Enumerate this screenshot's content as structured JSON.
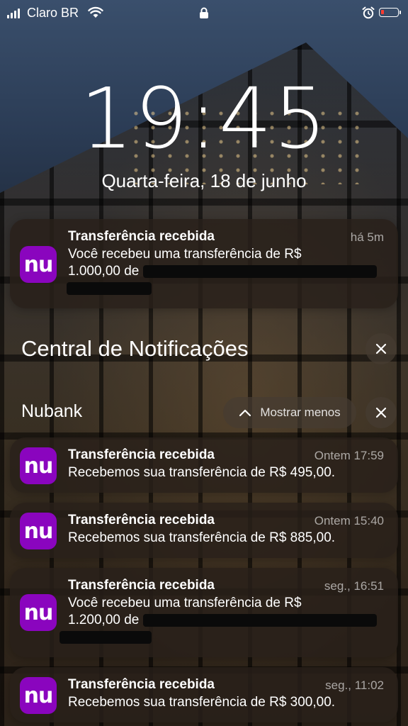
{
  "status_bar": {
    "carrier": "Claro BR"
  },
  "lock_screen": {
    "time": "19:45",
    "date": "Quarta-feira, 18 de junho"
  },
  "app_icon_text": "nu",
  "notifications_top": [
    {
      "title": "Transferência recebida",
      "time": "há 5m",
      "body_line1": "Você recebeu uma transferência de R$",
      "body_line2": "1.000,00 de"
    }
  ],
  "notification_center": {
    "title": "Central de Notificações"
  },
  "group": {
    "name": "Nubank",
    "show_less_label": "Mostrar menos"
  },
  "notifications": [
    {
      "title": "Transferência recebida",
      "time": "Ontem 17:59",
      "body": "Recebemos sua transferência de R$ 495,00."
    },
    {
      "title": "Transferência recebida",
      "time": "Ontem 15:40",
      "body": "Recebemos sua transferência de R$ 885,00."
    },
    {
      "title": "Transferência recebida",
      "time": "seg., 16:51",
      "body_line1": "Você recebeu uma transferência de R$",
      "body_line2": "1.200,00 de"
    },
    {
      "title": "Transferência recebida",
      "time": "seg., 11:02",
      "body": "Recebemos sua transferência de R$ 300,00."
    }
  ],
  "colors": {
    "nubank_purple": "#8a05be",
    "battery_low": "#ff3b30"
  }
}
